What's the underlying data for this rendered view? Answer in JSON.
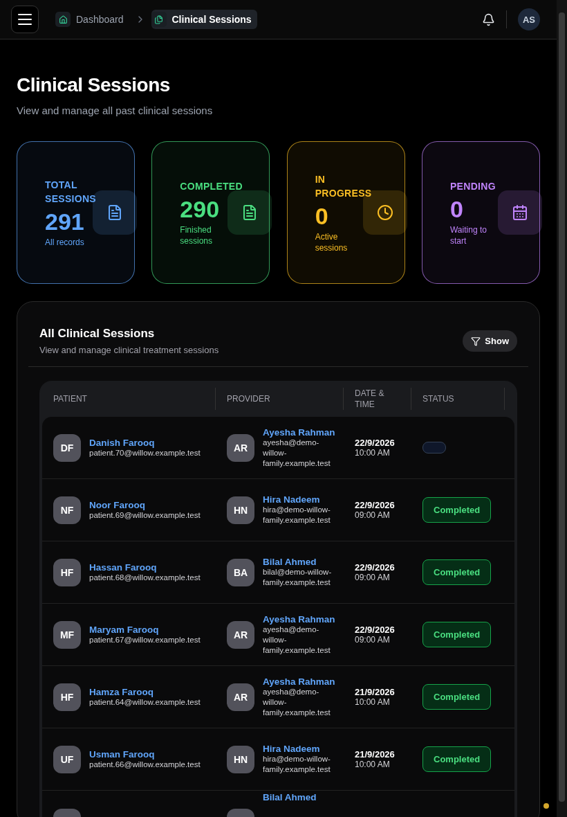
{
  "topbar": {
    "breadcrumbs": [
      {
        "label": "Dashboard",
        "selected": false
      },
      {
        "label": "Clinical Sessions",
        "selected": true
      }
    ],
    "user_initials": "AS"
  },
  "header": {
    "title": "Clinical Sessions",
    "subtitle": "View and manage all past clinical sessions"
  },
  "stats": [
    {
      "label": "TOTAL SESSIONS",
      "value": "291",
      "caption": "All records",
      "color": "#60a5fa"
    },
    {
      "label": "COMPLETED",
      "value": "290",
      "caption": "Finished sessions",
      "color": "#4ade80"
    },
    {
      "label": "IN PROGRESS",
      "value": "0",
      "caption": "Active sessions",
      "color": "#fbbf24"
    },
    {
      "label": "PENDING",
      "value": "0",
      "caption": "Waiting to start",
      "color": "#c084fc"
    }
  ],
  "panel": {
    "title": "All Clinical Sessions",
    "subtitle": "View and manage clinical treatment sessions",
    "filter_button": "Show"
  },
  "table": {
    "columns": [
      "PATIENT",
      "PROVIDER",
      "DATE & TIME",
      "STATUS"
    ],
    "rows": [
      {
        "kind": "full",
        "patient_initials": "DF",
        "patient": "Danish Farooq",
        "patient_email": "patient.70@willow.example.test",
        "provider_initials": "AR",
        "provider": "Ayesha Rahman",
        "provider_email": "ayesha@demo-willow-family.example.test",
        "date": "22/9/2026",
        "time": "10:00 AM",
        "status": {
          "kind": "blank"
        }
      },
      {
        "kind": "full",
        "patient_initials": "NF",
        "patient": "Noor Farooq",
        "patient_email": "patient.69@willow.example.test",
        "provider_initials": "HN",
        "provider": "Hira Nadeem",
        "provider_email": "hira@demo-willow-family.example.test",
        "date": "22/9/2026",
        "time": "09:00 AM",
        "status": {
          "kind": "completed",
          "label": "Completed"
        }
      },
      {
        "kind": "full",
        "patient_initials": "HF",
        "patient": "Hassan Farooq",
        "patient_email": "patient.68@willow.example.test",
        "provider_initials": "BA",
        "provider": "Bilal Ahmed",
        "provider_email": "bilal@demo-willow-family.example.test",
        "date": "22/9/2026",
        "time": "09:00 AM",
        "status": {
          "kind": "completed",
          "label": "Completed"
        }
      },
      {
        "kind": "full",
        "patient_initials": "MF",
        "patient": "Maryam Farooq",
        "patient_email": "patient.67@willow.example.test",
        "provider_initials": "AR",
        "provider": "Ayesha Rahman",
        "provider_email": "ayesha@demo-willow-family.example.test",
        "date": "22/9/2026",
        "time": "09:00 AM",
        "status": {
          "kind": "completed",
          "label": "Completed"
        }
      },
      {
        "kind": "full",
        "patient_initials": "HF",
        "patient": "Hamza Farooq",
        "patient_email": "patient.64@willow.example.test",
        "provider_initials": "AR",
        "provider": "Ayesha Rahman",
        "provider_email": "ayesha@demo-willow-family.example.test",
        "date": "21/9/2026",
        "time": "10:00 AM",
        "status": {
          "kind": "completed",
          "label": "Completed"
        }
      },
      {
        "kind": "full",
        "patient_initials": "UF",
        "patient": "Usman Farooq",
        "patient_email": "patient.66@willow.example.test",
        "provider_initials": "HN",
        "provider": "Hira Nadeem",
        "provider_email": "hira@demo-willow-family.example.test",
        "date": "21/9/2026",
        "time": "10:00 AM",
        "status": {
          "kind": "completed",
          "label": "Completed"
        }
      },
      {
        "kind": "partial",
        "provider": "Bilal Ahmed"
      }
    ]
  }
}
